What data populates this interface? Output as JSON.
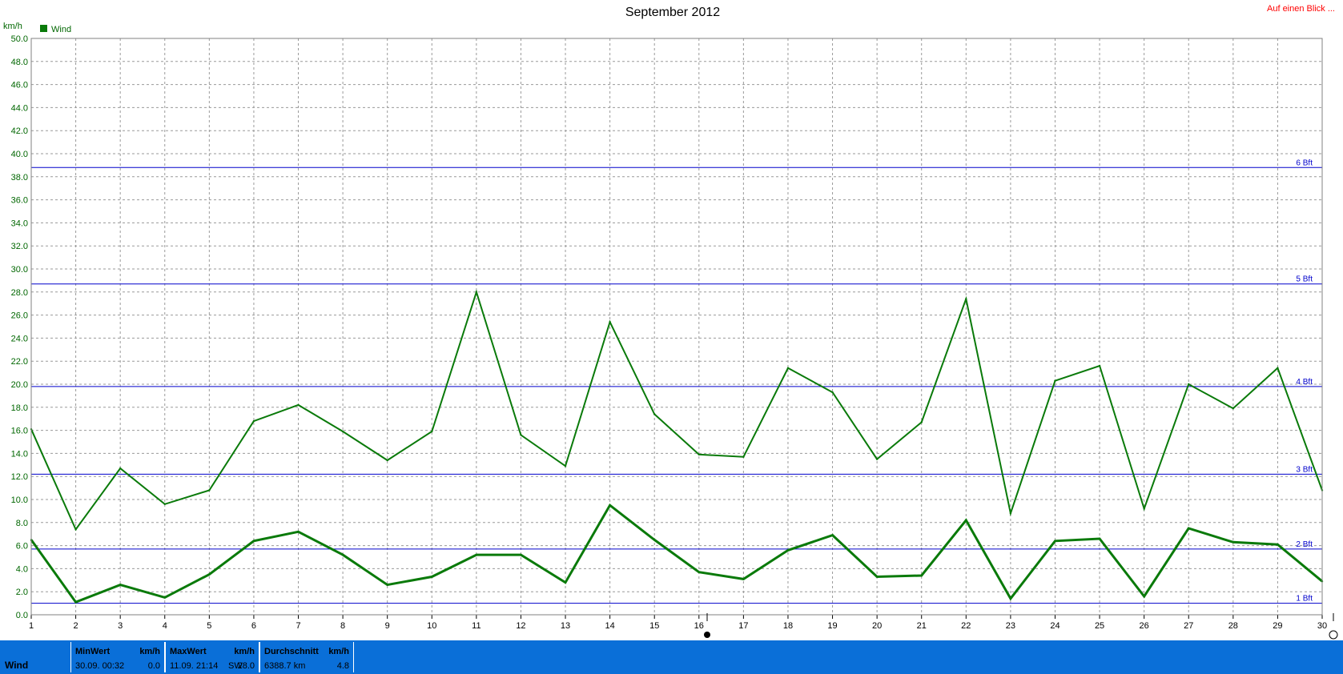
{
  "header": {
    "title": "September 2012",
    "unit": "km/h",
    "legend_label": "Wind",
    "top_link": "Auf einen Blick ..."
  },
  "colors": {
    "series": "#0a7a0a",
    "beaufort": "#0000cc",
    "grid": "#999999",
    "stats_bar": "#0a6fd8",
    "link": "#ff0000"
  },
  "chart_data": {
    "type": "line",
    "title": "September 2012",
    "ylabel": "km/h",
    "ylim": [
      0,
      50
    ],
    "ytick_step": 2,
    "x": [
      1,
      2,
      3,
      4,
      5,
      6,
      7,
      8,
      9,
      10,
      11,
      12,
      13,
      14,
      15,
      16,
      17,
      18,
      19,
      20,
      21,
      22,
      23,
      24,
      25,
      26,
      27,
      28,
      29,
      30
    ],
    "legend": [
      "Wind"
    ],
    "series": [
      {
        "name": "Wind",
        "role": "gust",
        "values": [
          16.1,
          7.4,
          12.7,
          9.6,
          10.8,
          16.8,
          18.2,
          15.9,
          13.4,
          15.9,
          28.0,
          15.6,
          12.9,
          25.4,
          17.4,
          13.9,
          13.7,
          21.4,
          19.3,
          13.5,
          16.7,
          27.4,
          8.8,
          20.3,
          21.6,
          9.2,
          20.0,
          17.9,
          21.4,
          10.8
        ]
      },
      {
        "name": "Wind",
        "role": "average",
        "values": [
          6.5,
          1.1,
          2.6,
          1.5,
          3.5,
          6.4,
          7.2,
          5.2,
          2.6,
          3.3,
          5.2,
          5.2,
          2.8,
          9.5,
          6.5,
          3.7,
          3.1,
          5.6,
          6.9,
          3.3,
          3.4,
          8.2,
          1.4,
          6.4,
          6.6,
          1.6,
          7.5,
          6.3,
          6.1,
          2.9
        ]
      }
    ],
    "beaufort_lines": [
      {
        "label": "1 Bft",
        "value": 1.0
      },
      {
        "label": "2 Bft",
        "value": 5.7
      },
      {
        "label": "3 Bft",
        "value": 12.2
      },
      {
        "label": "4 Bft",
        "value": 19.8
      },
      {
        "label": "5 Bft",
        "value": 28.7
      },
      {
        "label": "6 Bft",
        "value": 38.8
      }
    ],
    "grid": true,
    "legend_position": "top-left"
  },
  "stats": {
    "series_name": "Wind",
    "min": {
      "header": "MinWert",
      "unit": "km/h",
      "time": "30.09.  00:32",
      "value": "0.0"
    },
    "max": {
      "header": "MaxWert",
      "unit": "km/h",
      "time": "11.09.  21:14",
      "dir": "SW",
      "value": "28.0"
    },
    "avg": {
      "header": "Durchschnitt",
      "unit": "km/h",
      "distance": "6388.7 km",
      "value": "4.8"
    }
  }
}
